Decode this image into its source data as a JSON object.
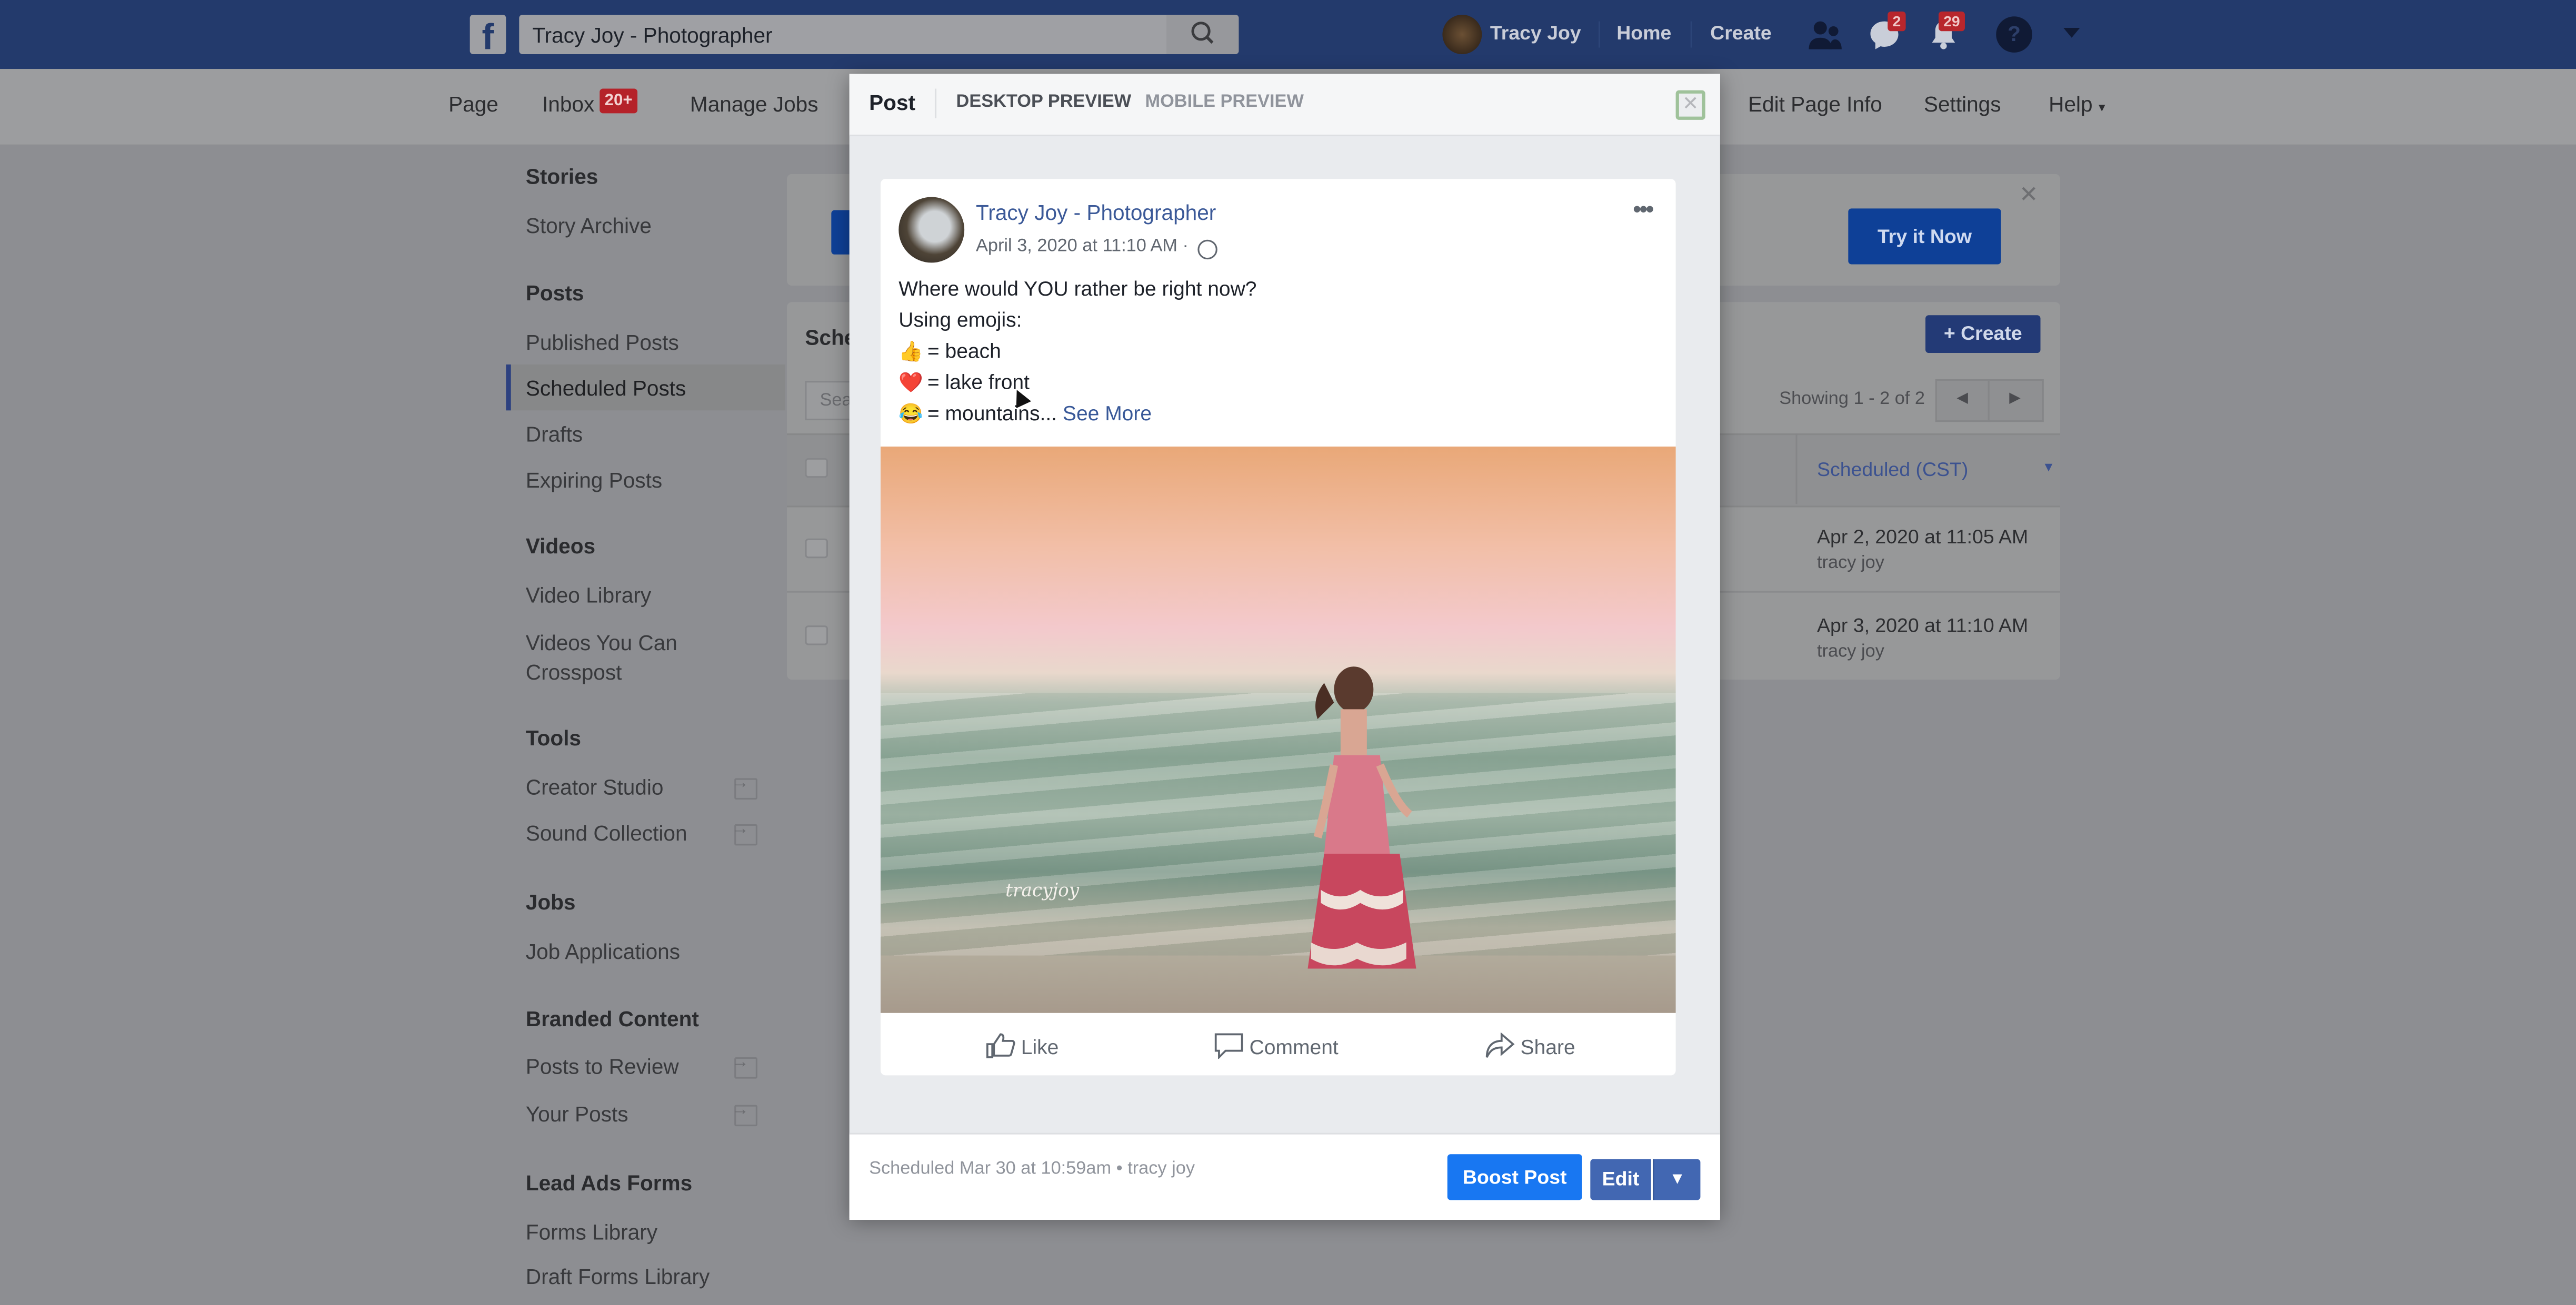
{
  "topbar": {
    "search_value": "Tracy Joy - Photographer",
    "profile_name": "Tracy Joy",
    "home_label": "Home",
    "create_label": "Create",
    "messages_badge": "2",
    "notifications_badge": "29"
  },
  "page_nav": {
    "items": [
      "Page",
      "Inbox",
      "Manage Jobs",
      "Edit Page Info",
      "Settings",
      "Help"
    ],
    "inbox_badge": "20+",
    "help_caret": "▾"
  },
  "sidebar": {
    "sections": [
      {
        "heading": "Stories",
        "items": [
          {
            "label": "Story Archive"
          }
        ]
      },
      {
        "heading": "Posts",
        "items": [
          {
            "label": "Published Posts"
          },
          {
            "label": "Scheduled Posts",
            "active": true
          },
          {
            "label": "Drafts"
          },
          {
            "label": "Expiring Posts"
          }
        ]
      },
      {
        "heading": "Videos",
        "items": [
          {
            "label": "Video Library"
          },
          {
            "label": "Videos You Can Crosspost"
          }
        ]
      },
      {
        "heading": "Tools",
        "items": [
          {
            "label": "Creator Studio",
            "external": true
          },
          {
            "label": "Sound Collection",
            "external": true
          }
        ]
      },
      {
        "heading": "Jobs",
        "items": [
          {
            "label": "Job Applications"
          }
        ]
      },
      {
        "heading": "Branded Content",
        "items": [
          {
            "label": "Posts to Review",
            "external": true
          },
          {
            "label": "Your Posts",
            "external": true
          }
        ]
      },
      {
        "heading": "Lead Ads Forms",
        "items": [
          {
            "label": "Forms Library"
          },
          {
            "label": "Draft Forms Library"
          }
        ]
      }
    ]
  },
  "background": {
    "promo_button": "Try it Now",
    "section_title_partial": "Sche",
    "search_placeholder_partial": "Sea",
    "create_button": "+ Create",
    "pagination_text": "Showing 1 - 2 of 2",
    "table": {
      "column": "Scheduled (CST)",
      "rows": [
        {
          "date": "Apr 2, 2020 at 11:05 AM",
          "user": "tracy joy"
        },
        {
          "date": "Apr 3, 2020 at 11:10 AM",
          "user": "tracy joy"
        }
      ]
    }
  },
  "modal": {
    "tabs": [
      "Post",
      "DESKTOP PREVIEW",
      "MOBILE PREVIEW"
    ],
    "active_tab": "DESKTOP PREVIEW",
    "post": {
      "page_name": "Tracy Joy - Photographer",
      "date": "April 3, 2020 at 11:10 AM ·",
      "lines": [
        {
          "emoji": "",
          "text": "Where would YOU rather be right now?"
        },
        {
          "emoji": "",
          "text": "Using emojis:"
        },
        {
          "emoji": "👍",
          "text": "= beach"
        },
        {
          "emoji": "❤️",
          "text": "= lake front"
        },
        {
          "emoji": "😂",
          "text": "= mountains..."
        }
      ],
      "see_more": "See More",
      "photo_watermark": "tracyjoy",
      "actions": [
        "Like",
        "Comment",
        "Share"
      ]
    },
    "footer": {
      "status": "Scheduled Mar 30 at 10:59am • tracy joy",
      "boost_button": "Boost Post",
      "edit_button": "Edit"
    }
  }
}
